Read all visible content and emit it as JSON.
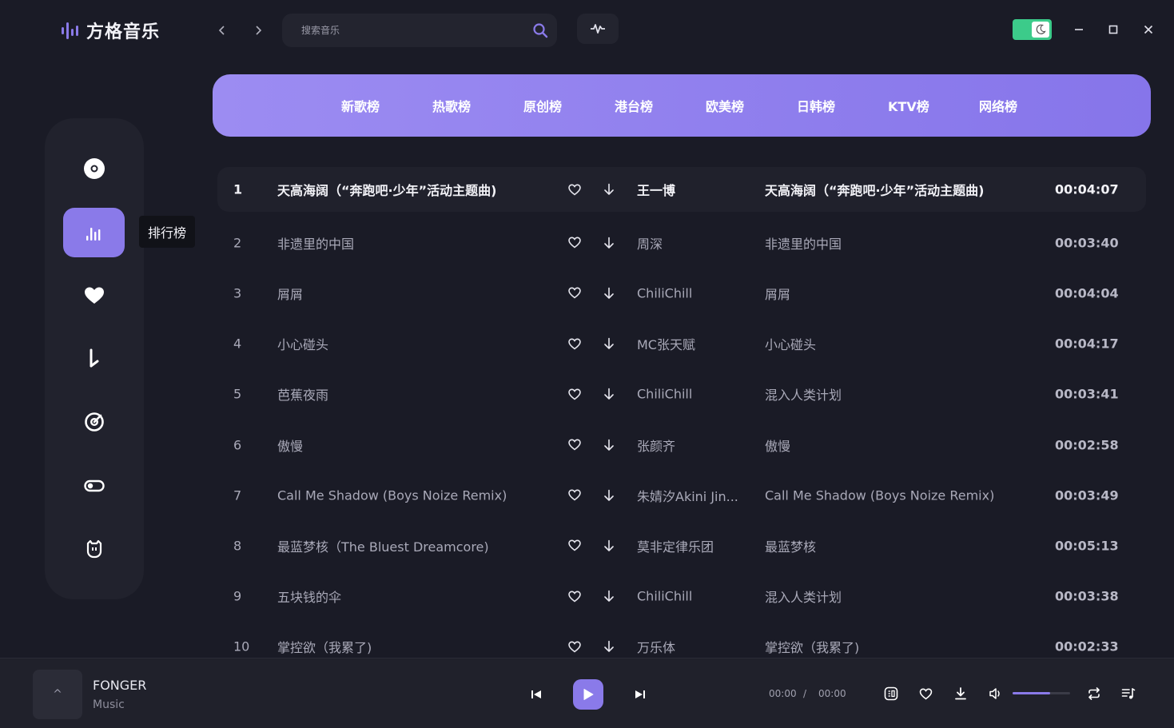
{
  "app": {
    "name": "方格音乐"
  },
  "search": {
    "placeholder": "搜索音乐",
    "value": ""
  },
  "sidebar": {
    "tooltip": "排行榜"
  },
  "tabs": [
    "新歌榜",
    "热歌榜",
    "原创榜",
    "港台榜",
    "欧美榜",
    "日韩榜",
    "KTV榜",
    "网络榜"
  ],
  "songs": [
    {
      "idx": "1",
      "title": "天高海阔（“奔跑吧·少年”活动主题曲)",
      "artist": "王一博",
      "album": "天高海阔（“奔跑吧·少年”活动主题曲)",
      "duration": "00:04:07"
    },
    {
      "idx": "2",
      "title": "非遗里的中国",
      "artist": "周深",
      "album": "非遗里的中国",
      "duration": "00:03:40"
    },
    {
      "idx": "3",
      "title": "屑屑",
      "artist": "ChiliChill",
      "album": "屑屑",
      "duration": "00:04:04"
    },
    {
      "idx": "4",
      "title": "小心碰头",
      "artist": "MC张天赋",
      "album": "小心碰头",
      "duration": "00:04:17"
    },
    {
      "idx": "5",
      "title": "芭蕉夜雨",
      "artist": "ChiliChill",
      "album": "混入人类计划",
      "duration": "00:03:41"
    },
    {
      "idx": "6",
      "title": "傲慢",
      "artist": "张颜齐",
      "album": "傲慢",
      "duration": "00:02:58"
    },
    {
      "idx": "7",
      "title": "Call Me Shadow (Boys Noize Remix)",
      "artist": "朱婧汐Akini Jin...",
      "album": "Call Me Shadow (Boys Noize Remix)",
      "duration": "00:03:49"
    },
    {
      "idx": "8",
      "title": "最蓝梦核（The Bluest Dreamcore)",
      "artist": "莫非定律乐团",
      "album": "最蓝梦核",
      "duration": "00:05:13"
    },
    {
      "idx": "9",
      "title": "五块钱的伞",
      "artist": "ChiliChill",
      "album": "混入人类计划",
      "duration": "00:03:38"
    },
    {
      "idx": "10",
      "title": "掌控欲（我累了)",
      "artist": "万乐体",
      "album": "掌控欲（我累了)",
      "duration": "00:02:33"
    }
  ],
  "player": {
    "cover_caret": "^",
    "title": "FONGER",
    "subtitle": "Music",
    "current_time": "00:00",
    "separator": "/",
    "total_time": "00:00",
    "volume": 0.65
  },
  "colors": {
    "accent": "#8a7ae9",
    "toggle": "#3ccb8a",
    "background": "#1a1b26"
  }
}
